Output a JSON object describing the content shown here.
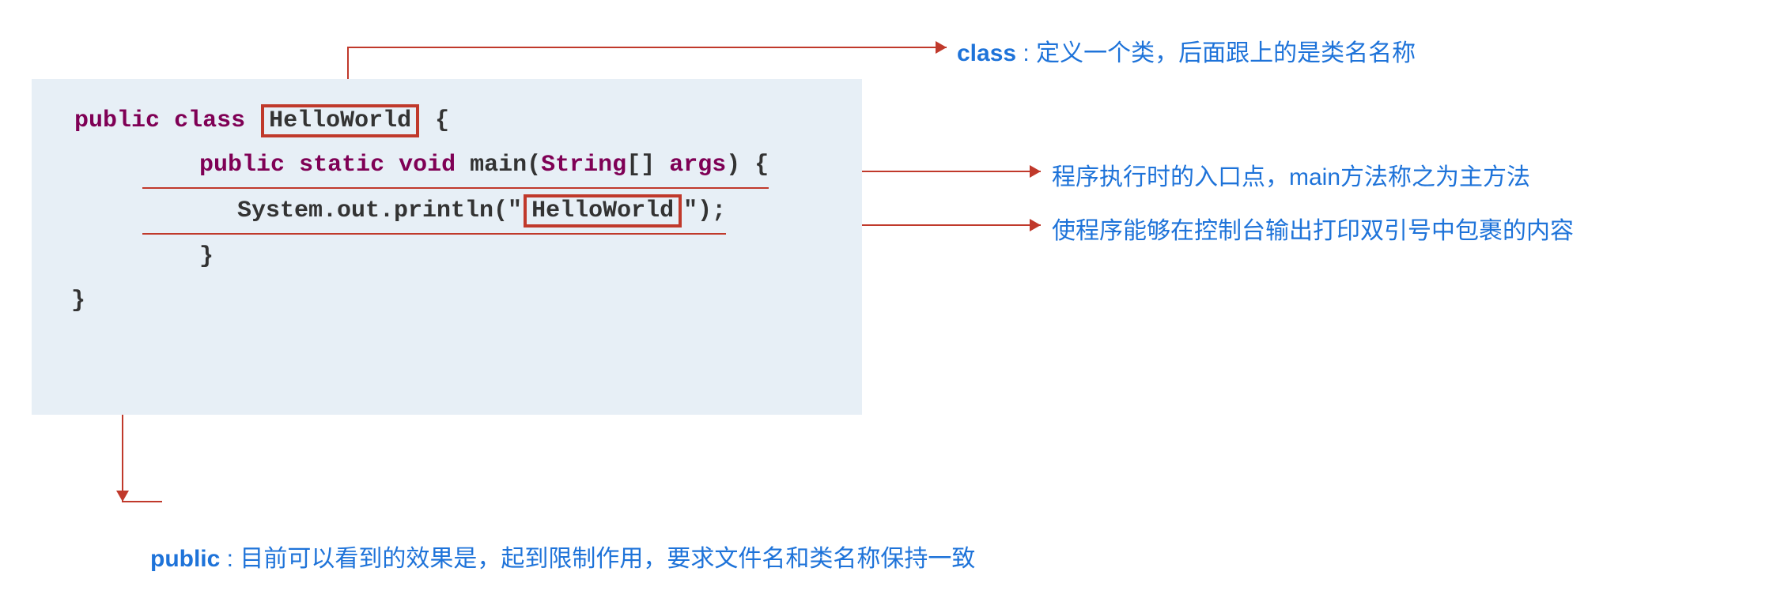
{
  "code": {
    "line1_public": "public",
    "line1_class": "class",
    "line1_name": "HelloWorld",
    "line1_brace": " {",
    "indent1": "   ",
    "line2_public": "public",
    "line2_static": "static",
    "line2_void": "void",
    "line2_main": " main(",
    "line2_string": "String",
    "line2_bracket": "[] ",
    "line2_args": "args",
    "line2_close": ") {",
    "indent2": "    ",
    "line3_prefix": "System.out.println(\"",
    "line3_text": "HelloWorld",
    "line3_suffix": "\");",
    "line4": "    }",
    "line5": "}"
  },
  "annotations": {
    "class_label": "class",
    "class_text": " : 定义一个类，后面跟上的是类名名称",
    "main_text": "程序执行时的入口点，main方法称之为主方法",
    "println_text": "使程序能够在控制台输出打印双引号中包裹的内容",
    "public_label": "public",
    "public_text": " : 目前可以看到的效果是，起到限制作用，要求文件名和类名称保持一致"
  },
  "colors": {
    "keyword": "#7f0055",
    "highlight_border": "#c0392b",
    "annotation": "#1e73d9",
    "code_bg": "#e7eff6"
  }
}
